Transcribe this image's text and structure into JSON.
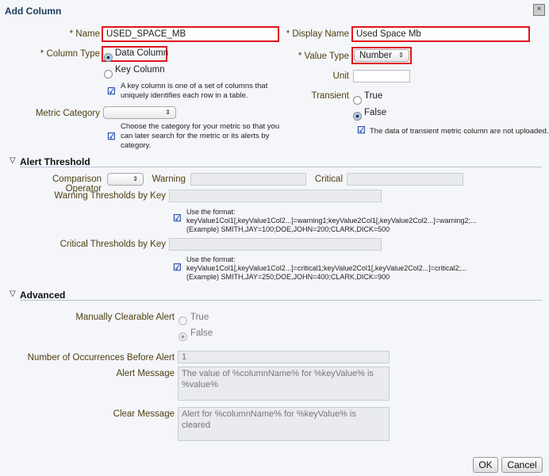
{
  "dialog": {
    "title": "Add Column",
    "close": "×"
  },
  "form": {
    "name_label": "* Name",
    "name_value": "USED_SPACE_MB",
    "display_name_label": "* Display Name",
    "display_name_value": "Used Space Mb",
    "column_type_label": "* Column Type",
    "data_column": "Data Column",
    "key_column": "Key Column",
    "key_hint": [
      "A key column is one of a set of columns that",
      "uniquely identifies each row in a table."
    ],
    "value_type_label": "* Value Type",
    "value_type_value": "Number",
    "unit_label": "Unit",
    "unit_value": "",
    "transient_label": "Transient",
    "transient_true": "True",
    "transient_false": "False",
    "transient_hint": "The data of transient metric column are not uploaded.",
    "metric_category_label": "Metric Category",
    "metric_hint": [
      "Choose the category for your metric so that you",
      "can later search for the metric or its alerts by",
      "category."
    ]
  },
  "alert": {
    "title": "Alert Threshold",
    "comparison_label": "Comparison Operator",
    "warning_label": "Warning",
    "critical_label": "Critical",
    "warning_key_label": "Warning Thresholds by Key",
    "warning_hint": [
      "Use the format:",
      "keyValue1Col1[,keyValue1Col2...]=warning1;keyValue2Col1[,keyValue2Col2...]=warning2;...",
      "(Example) SMITH,JAY=100;DOE,JOHN=200;CLARK,DICK=500"
    ],
    "critical_key_label": "Critical Thresholds by Key",
    "critical_hint": [
      "Use the format:",
      "keyValue1Col1[,keyValue1Col2...]=critical1;keyValue2Col1[,keyValue2Col2...]=critical2;...",
      "(Example) SMITH,JAY=250;DOE,JOHN=400;CLARK,DICK=900"
    ]
  },
  "advanced": {
    "title": "Advanced",
    "clearable_label": "Manually Clearable Alert",
    "true": "True",
    "false": "False",
    "occurrences_label": "Number of Occurrences Before Alert",
    "occurrences_value": "1",
    "alert_message_label": "Alert Message",
    "alert_message_value": "The value of %columnName% for %keyValue% is %value%",
    "clear_message_label": "Clear Message",
    "clear_message_value": "Alert for %columnName% for %keyValue% is cleared"
  },
  "buttons": {
    "ok": "OK",
    "cancel": "Cancel"
  }
}
